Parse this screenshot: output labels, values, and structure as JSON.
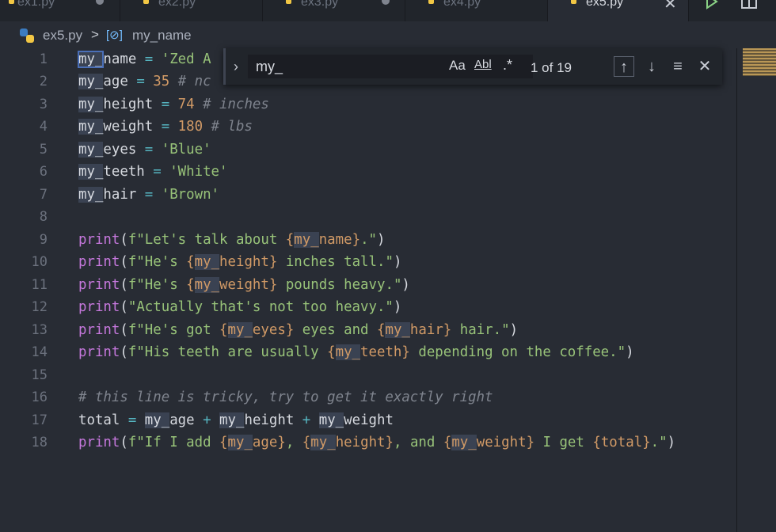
{
  "tabs": [
    {
      "label": "ex1.py",
      "active": false,
      "dirty": true
    },
    {
      "label": "ex2.py",
      "active": false,
      "dirty": false
    },
    {
      "label": "ex3.py",
      "active": false,
      "dirty": true
    },
    {
      "label": "ex4.py",
      "active": false,
      "dirty": false
    },
    {
      "label": "ex5.py",
      "active": true,
      "dirty": false
    }
  ],
  "breadcrumb": {
    "file": "ex5.py",
    "separator": ">",
    "symbol_icon": "[⊘]",
    "symbol": "my_name"
  },
  "find": {
    "query": "my_",
    "match_case": "Aa",
    "whole_word": "Abl",
    "regex": ".*",
    "count": "1 of 19"
  },
  "line_numbers": [
    "1",
    "2",
    "3",
    "4",
    "5",
    "6",
    "7",
    "8",
    "9",
    "10",
    "11",
    "12",
    "13",
    "14",
    "15",
    "16",
    "17",
    "18"
  ],
  "code": {
    "l1": {
      "a": "my_",
      "b": "name",
      "c": " = ",
      "d": "'Zed A"
    },
    "l2": {
      "a": "my_",
      "b": "age",
      "c": " = ",
      "d": "35",
      "e": " # nc"
    },
    "l3": {
      "a": "my_",
      "b": "height",
      "c": " = ",
      "d": "74",
      "e": " # inches"
    },
    "l4": {
      "a": "my_",
      "b": "weight",
      "c": " = ",
      "d": "180",
      "e": " # lbs"
    },
    "l5": {
      "a": "my_",
      "b": "eyes",
      "c": " = ",
      "d": "'Blue'"
    },
    "l6": {
      "a": "my_",
      "b": "teeth",
      "c": " = ",
      "d": "'White'"
    },
    "l7": {
      "a": "my_",
      "b": "hair",
      "c": " = ",
      "d": "'Brown'"
    },
    "l9": {
      "fn": "print",
      "o": "(",
      "s1": "f\"Let's talk about ",
      "b1": "{",
      "h": "my_",
      "v": "name",
      "b2": "}",
      "s2": ".\"",
      "cl": ")"
    },
    "l10": {
      "fn": "print",
      "o": "(",
      "s1": "f\"He's ",
      "b1": "{",
      "h": "my_",
      "v": "height",
      "b2": "}",
      "s2": " inches tall.\"",
      "cl": ")"
    },
    "l11": {
      "fn": "print",
      "o": "(",
      "s1": "f\"He's ",
      "b1": "{",
      "h": "my_",
      "v": "weight",
      "b2": "}",
      "s2": " pounds heavy.\"",
      "cl": ")"
    },
    "l12": {
      "fn": "print",
      "o": "(",
      "s1": "\"Actually that's not too heavy.\"",
      "cl": ")"
    },
    "l13": {
      "fn": "print",
      "o": "(",
      "s1": "f\"He's got ",
      "b1": "{",
      "h": "my_",
      "v": "eyes",
      "b2": "}",
      "s2": " eyes and ",
      "b3": "{",
      "h2": "my_",
      "v2": "hair",
      "b4": "}",
      "s3": " hair.\"",
      "cl": ")"
    },
    "l14": {
      "fn": "print",
      "o": "(",
      "s1": "f\"His teeth are usually ",
      "b1": "{",
      "h": "my_",
      "v": "teeth",
      "b2": "}",
      "s2": " depending on the coffee.\"",
      "cl": ")"
    },
    "l16": {
      "cm": "# this line is tricky, try to get it exactly right"
    },
    "l17": {
      "a": "total",
      "c": " = ",
      "h1": "my_",
      "v1": "age",
      "p1": " + ",
      "h2": "my_",
      "v2": "height",
      "p2": " + ",
      "h3": "my_",
      "v3": "weight"
    },
    "l18": {
      "fn": "print",
      "o": "(",
      "s1": "f\"If I add ",
      "b1": "{",
      "h1": "my_",
      "v1": "age",
      "b2": "}",
      "s2": ", ",
      "b3": "{",
      "h2": "my_",
      "v2": "height",
      "b4": "}",
      "s3": ", and ",
      "b5": "{",
      "h3": "my_",
      "v3": "weight",
      "b6": "}",
      "s4": " I get ",
      "b7": "{",
      "t": "total",
      "b8": "}",
      "s5": ".\"",
      "cl": ")"
    }
  },
  "colors": {
    "keyword": "#c678dd",
    "string": "#98c379",
    "number": "#d19a66",
    "operator": "#56b6c2",
    "comment": "#7f848e",
    "highlight": "#3a4252"
  }
}
